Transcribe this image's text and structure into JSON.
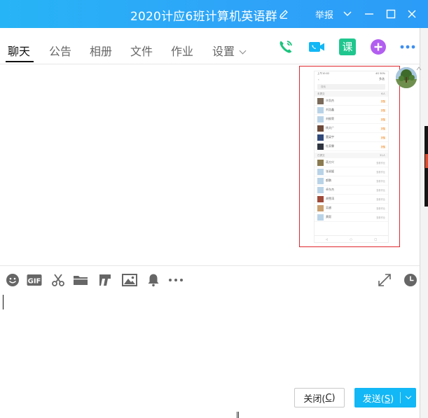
{
  "window": {
    "title": "2020计应6班计算机英语群",
    "report_label": "举报"
  },
  "tabs": [
    {
      "label": "聊天"
    },
    {
      "label": "公告"
    },
    {
      "label": "相册"
    },
    {
      "label": "文件"
    },
    {
      "label": "作业"
    },
    {
      "label": "设置"
    }
  ],
  "actions": {
    "course_label": "课"
  },
  "screenshot_message": {
    "status_left": "上午10:02",
    "status_right": "4G 50%",
    "nav_right": "多选",
    "search_placeholder": "搜索",
    "unsubmitted_header": "未提交",
    "unsubmitted_count": "6人",
    "submitted_header": "已提交",
    "submitted_count": "31人",
    "unsubmitted": [
      {
        "name": "许凯杰",
        "tag": "提醒"
      },
      {
        "name": "刘浩鑫",
        "tag": "提醒"
      },
      {
        "name": "刘郁荣",
        "tag": "提醒"
      },
      {
        "name": "杨文广",
        "tag": "提醒"
      },
      {
        "name": "董梁宇",
        "tag": "提醒"
      },
      {
        "name": "杜家霖",
        "tag": "提醒"
      }
    ],
    "submitted": [
      {
        "name": "蒋方兴",
        "tag": "查看作业"
      },
      {
        "name": "张淑媛",
        "tag": "查看作业"
      },
      {
        "name": "都鹏",
        "tag": "查看作业"
      },
      {
        "name": "卓东杰",
        "tag": "查看作业"
      },
      {
        "name": "胡雪涛",
        "tag": "查看作业"
      },
      {
        "name": "吴越",
        "tag": "查看作业"
      },
      {
        "name": "黄毅",
        "tag": "查看作业"
      }
    ]
  },
  "composer": {
    "text": ""
  },
  "buttons": {
    "close_label": "关闭(",
    "close_key": "C",
    "close_suffix": ")",
    "send_label": "发送(",
    "send_key": "S",
    "send_suffix": ")"
  },
  "colors": {
    "titlebar": "#2ea4f8",
    "send_button": "#12b7f5",
    "highlight_border": "#e0282e",
    "phone_green": "#1bc47d",
    "video_blue": "#12b7f5",
    "course_green": "#1fc68e",
    "app_purple": "#b25ef0",
    "more_blue": "#3d8ef0"
  }
}
